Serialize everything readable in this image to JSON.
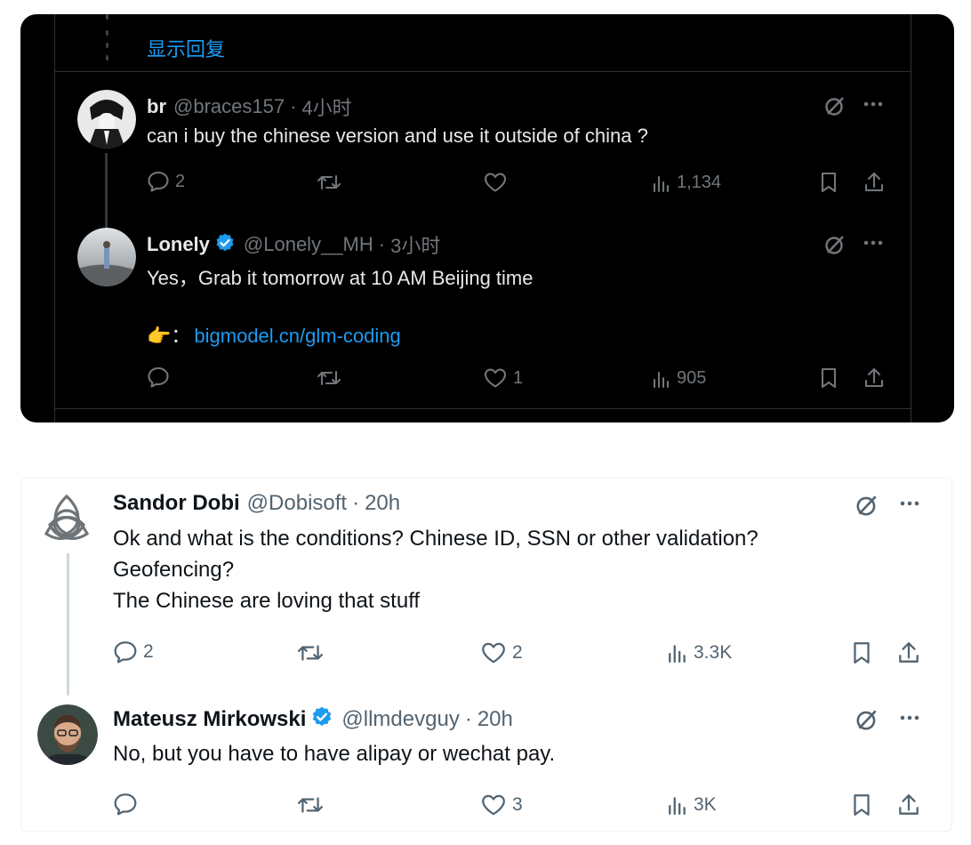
{
  "dark_thread": {
    "show_replies_label": "显示回复",
    "tweets": [
      {
        "name": "br",
        "handle": "@braces157",
        "separator": "·",
        "time": "4小时",
        "text": "can i buy the chinese version and use it outside of china ?",
        "replies": "2",
        "retweets": "",
        "likes": "",
        "views": "1,134"
      },
      {
        "name": "Lonely",
        "verified": true,
        "handle": "@Lonely__MH",
        "separator": "·",
        "time": "3小时",
        "text": "Yes，Grab it tomorrow at 10 AM Beijing time",
        "link_prefix": "👉：",
        "link": "bigmodel.cn/glm-coding",
        "replies": "",
        "retweets": "",
        "likes": "1",
        "views": "905"
      }
    ]
  },
  "light_thread": {
    "tweets": [
      {
        "name": "Sandor Dobi",
        "handle": "@Dobisoft",
        "separator": "·",
        "time": "20h",
        "text_lines": [
          "Ok and what is the conditions? Chinese ID, SSN or other validation?",
          "Geofencing?",
          "The Chinese are loving that stuff"
        ],
        "replies": "2",
        "retweets": "",
        "likes": "2",
        "views": "3.3K"
      },
      {
        "name": "Mateusz Mirkowski",
        "verified": true,
        "handle": "@llmdevguy",
        "separator": "·",
        "time": "20h",
        "text": "No, but you have to have alipay or wechat pay.",
        "replies": "",
        "retweets": "",
        "likes": "3",
        "views": "3K"
      }
    ]
  },
  "colors": {
    "dark_bg": "#000000",
    "accent_blue": "#1d9bf0",
    "dark_text": "#e7e9ea",
    "dark_muted": "#71767b",
    "light_text": "#0f1419",
    "light_muted": "#536471"
  }
}
